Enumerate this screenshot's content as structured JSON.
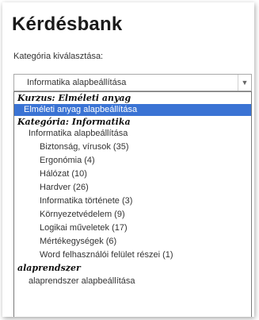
{
  "page": {
    "title": "Kérdésbank",
    "category_label": "Kategória kiválasztása:"
  },
  "select": {
    "value": "Informatika alapbeállítása"
  },
  "listbox": {
    "items": [
      {
        "label": "Kurzus: Elméleti anyag",
        "type": "group"
      },
      {
        "label": "Elméleti anyag alapbeállítása",
        "type": "option",
        "selected": true
      },
      {
        "label": "Kategória: Informatika",
        "type": "group"
      },
      {
        "label": "Informatika alapbeállítása",
        "type": "option"
      },
      {
        "label": "Biztonság, vírusok (35)",
        "type": "option"
      },
      {
        "label": "Ergonómia (4)",
        "type": "option"
      },
      {
        "label": "Hálózat (10)",
        "type": "option"
      },
      {
        "label": "Hardver (26)",
        "type": "option"
      },
      {
        "label": "Informatika története (3)",
        "type": "option"
      },
      {
        "label": "Környezetvédelem (9)",
        "type": "option"
      },
      {
        "label": "Logikai műveletek (17)",
        "type": "option"
      },
      {
        "label": "Mértékegységek (6)",
        "type": "option"
      },
      {
        "label": "Word felhasználói felület részei (1)",
        "type": "option"
      },
      {
        "label": "alaprendszer",
        "type": "group"
      },
      {
        "label": "alaprendszer alapbeállítása",
        "type": "option"
      }
    ]
  },
  "colors": {
    "selected_background": "#3a73d4",
    "selected_text": "#ffffff"
  }
}
